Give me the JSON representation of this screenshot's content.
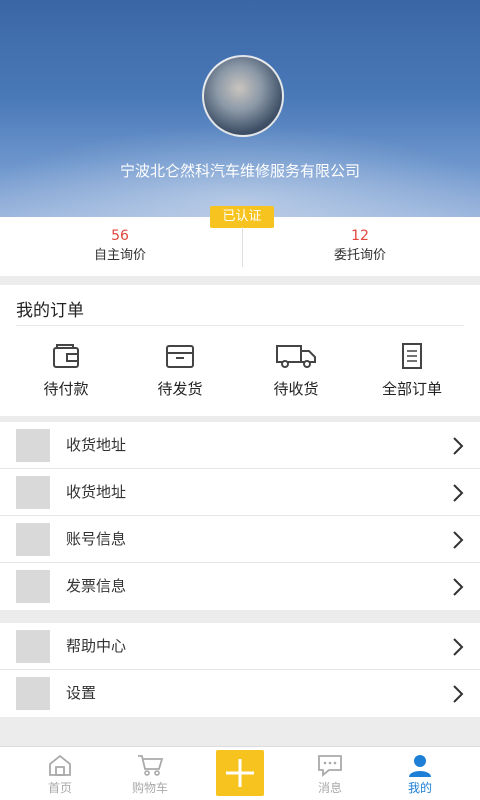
{
  "profile": {
    "company": "宁波北仑然科汽车维修服务有限公司",
    "badge": "已认证"
  },
  "stats": [
    {
      "value": "56",
      "label": "自主询价"
    },
    {
      "value": "12",
      "label": "委托询价"
    }
  ],
  "orders": {
    "title": "我的订单",
    "items": [
      {
        "label": "待付款",
        "icon": "wallet-icon"
      },
      {
        "label": "待发货",
        "icon": "box-icon"
      },
      {
        "label": "待收货",
        "icon": "truck-icon"
      },
      {
        "label": "全部订单",
        "icon": "document-icon"
      }
    ]
  },
  "menu_group1": [
    "收货地址",
    "收货地址",
    "账号信息",
    "发票信息"
  ],
  "menu_group2": [
    "帮助中心",
    "设置"
  ],
  "tabbar": [
    {
      "label": "首页",
      "icon": "home-icon"
    },
    {
      "label": "购物车",
      "icon": "cart-icon"
    },
    {
      "label": "",
      "icon": "plus-icon"
    },
    {
      "label": "消息",
      "icon": "message-icon"
    },
    {
      "label": "我的",
      "icon": "user-icon"
    }
  ],
  "colors": {
    "accent": "#f7c31e",
    "active_tab": "#1e7fd6",
    "stat_number": "#e2473c"
  }
}
